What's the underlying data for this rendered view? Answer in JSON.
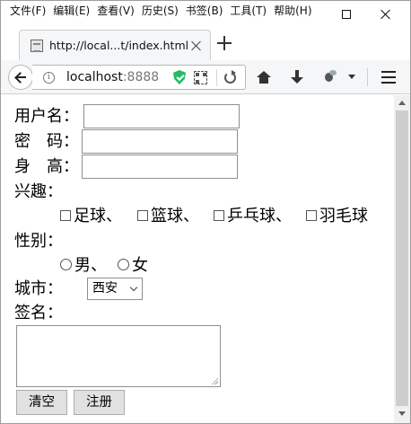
{
  "menu": [
    "文件(F)",
    "编辑(E)",
    "查看(V)",
    "历史(S)",
    "书签(B)",
    "工具(T)",
    "帮助(H)"
  ],
  "tab": {
    "title": "http://local...t/index.html"
  },
  "url": {
    "host": "localhost",
    "port": ":8888"
  },
  "form": {
    "username_label": "用户名：",
    "password_label": "密　码：",
    "height_label": "身　高：",
    "hobby_label": "兴趣：",
    "hobbies": [
      "足球、",
      "篮球、",
      "乒乓球、",
      "羽毛球"
    ],
    "gender_label": "性别：",
    "genders": [
      "男、",
      "女"
    ],
    "city_label": "城市：",
    "city_selected": "西安",
    "signature_label": "签名：",
    "reset_label": "清空",
    "submit_label": "注册",
    "username_value": "",
    "password_value": "",
    "height_value": "",
    "signature_value": ""
  },
  "icons": [
    "info-icon",
    "shield-check-icon",
    "qr-code-icon",
    "reload-icon",
    "home-icon",
    "download-icon",
    "bug-icon",
    "hamburger-menu-icon"
  ]
}
